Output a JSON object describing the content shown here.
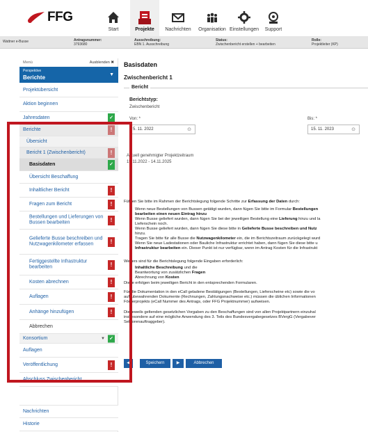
{
  "brand": {
    "name": "FFG",
    "accent": "#c0161f",
    "nav_active_bg": "#efefef",
    "link_color": "#1e5fa5"
  },
  "nav": {
    "items": [
      {
        "label": "Start",
        "icon": "home-icon"
      },
      {
        "label": "Projekte",
        "icon": "folder-icon",
        "active": true
      },
      {
        "label": "Nachrichten",
        "icon": "mail-icon"
      },
      {
        "label": "Organisation",
        "icon": "people-icon"
      },
      {
        "label": "Einstellungen",
        "icon": "gear-icon"
      },
      {
        "label": "Support",
        "icon": "support-icon"
      }
    ]
  },
  "infobar": {
    "project": "Wattner e-Busse",
    "antrag_label": "Antragsnummer:",
    "antrag_value": "3793680",
    "ausschreibung_label": "Ausschreibung:",
    "ausschreibung_value": "EBN 1. Ausschreibung",
    "status_label": "Status:",
    "status_value": "Zwischenbericht erstellen + bearbeiten",
    "rolle_label": "Rolle:",
    "rolle_value": "Projektleiter (KP)"
  },
  "sidebar": {
    "menu_label": "Menü",
    "hide_label": "Ausblenden ✖",
    "perspective_small": "Perspektive",
    "perspective_value": "Berichte",
    "items": [
      {
        "label": "Projektübersicht"
      },
      {
        "label": "Aktion beginnen"
      },
      {
        "label": "Jahresdaten",
        "badge": "✓"
      },
      {
        "label": "Berichte",
        "badge": "!"
      },
      {
        "label": "Übersicht"
      },
      {
        "label": "Bericht 1 (Zwischenbericht)",
        "badge": "!"
      },
      {
        "label": "Basisdaten",
        "badge": "✓"
      },
      {
        "label": "Übersicht Beschaffung"
      },
      {
        "label": "Inhaltlicher Bericht",
        "badge": "!"
      },
      {
        "label": "Fragen zum Bericht",
        "badge": "!"
      },
      {
        "label": "Bestellungen und Lieferungen von Bussen bearbeiten",
        "badge": "!"
      },
      {
        "label": "Gelieferte Busse beschreiben und Nutzwagenkilometer erfassen",
        "badge": "!"
      },
      {
        "label": "Fertiggestellte Infrastruktur bearbeiten",
        "badge": "!"
      },
      {
        "label": "Kosten abrechnen",
        "badge": "!"
      },
      {
        "label": "Auflagen",
        "badge": "!"
      },
      {
        "label": "Anhänge hinzufügen",
        "badge": "!"
      },
      {
        "label": "Abbrechen"
      },
      {
        "label": "Konsortium",
        "badge": "✓"
      },
      {
        "label": "Auflagen"
      },
      {
        "label": "Veröffentlichung",
        "badge": "!"
      },
      {
        "label": "Abschluss Zwischenbericht"
      },
      {
        "label": "Nachrichten"
      },
      {
        "label": "Historie"
      }
    ]
  },
  "main": {
    "title": "Basisdaten",
    "subtitle": "Zwischenbericht 1",
    "legend": "Bericht",
    "berichtstyp_label": "Berichtstyp:",
    "berichtstyp_value": "Zwischenbericht",
    "von_label": "Von: *",
    "von_value": "5. 11. 2022",
    "bis_label": "Bis: *",
    "bis_value": "15. 11. 2023",
    "zeitraum_label": "Aktuell genehmigter Projektzeitraum",
    "zeitraum_value": "15.11.2022 - 14.11.2025",
    "instructions_intro": "Führen Sie bitte im Rahmen der Berichtslegung folgende Schritte zur",
    "instructions_intro_bold": "Erfassung der Daten",
    "instructions_intro_end": "durch:",
    "bullets": [
      "Wenn neue Bestellungen von Bussen getätigt wurden, dann fügen Sie bitte im Formular",
      "bearbeiten einen neuen Eintrag hinzu",
      "Wenn Busse geliefert wurden, dann fügen Sie bei der jeweiligen Bestellung eine",
      "Lieferschein noch.",
      "Wenn Busse geliefert wurden, dann fügen Sie diese bitte in",
      "hinzu.",
      "Tragen Sie bitte für alle Busse die",
      "Wenn Sie neue Ladestationen oder Bauliche Infrastruktur errichtet haben, dann fügen Sie diese bitte u",
      "Infrastruktur bearbeiten"
    ],
    "bold_bits": {
      "bestellungen": "Bestellungen",
      "lieferung": "Lieferung",
      "lieferung_rest": "hinzu und la",
      "gelieferte": "Gelieferte Busse beschreiben und Nutz",
      "nutzwagen": "Nutzwagenkilometer",
      "nutzwagen_rest": "ein, die im Berichtszeitraum zurückgelegt wurd",
      "infra_rest": "ein. Dieser Punkt ist nur verfügbar, wenn im Antrag Kosten für die Infrastrukt"
    },
    "weiters": "Weiters sind für die Berichtslegung folgende Eingaben erforderlich:",
    "req1": "Inhaltliche Beschreibung",
    "req1_rest": "und die",
    "req2_pre": "Beantwortung von zusätzlichen",
    "req2": "Fragen",
    "req3_pre": "Abrechnung von",
    "req3": "Kosten",
    "req_note": "Diese erfolgen beim jeweiligen Bericht in den entsprechenden Formularen.",
    "doc_lines": [
      "Für die Dokumentation in den eCall geladene Bestätigungen (Bestellungen, Lieferscheine etc) sowie die vo",
      "aufzubewahrenden Dokumente (Rechnungen, Zahlungsnachweise etc.) müssen die üblichen Informationen",
      "Förderprojekts (eCall Nummer des Antrags, oder FFG Projektnummer) aufweisen."
    ],
    "law_lines": [
      "Die jeweils geltenden gesetzlichen Vorgaben zu den Beschaffungen sind von allen Projektpartnern einzuhal",
      "insbesondere auf eine mögliche Anwendung des 3. Teils des Bundesvergabegesetzes BVergG (Vergabever",
      "Sektorenauftraggeber)."
    ],
    "buttons": {
      "save": "Speichern",
      "cancel": "Abbrechen",
      "prev": "◀",
      "next": "▶"
    }
  }
}
